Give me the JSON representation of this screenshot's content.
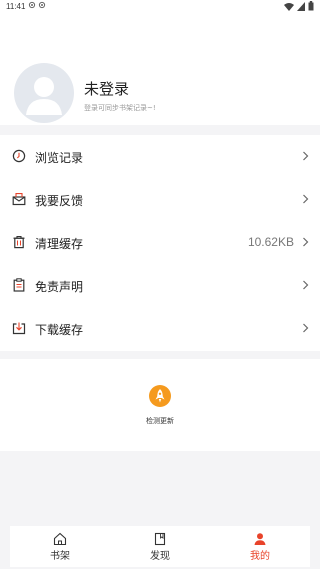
{
  "status_bar": {
    "time": "11:41"
  },
  "profile": {
    "name": "未登录",
    "subtitle": "登录可同步书架记录~!"
  },
  "menu": {
    "items": [
      {
        "label": "浏览记录",
        "icon": "history-icon"
      },
      {
        "label": "我要反馈",
        "icon": "feedback-icon"
      },
      {
        "label": "清理缓存",
        "icon": "trash-icon",
        "value": "10.62KB"
      },
      {
        "label": "免责声明",
        "icon": "clipboard-icon"
      },
      {
        "label": "下载缓存",
        "icon": "download-icon"
      }
    ]
  },
  "update": {
    "label": "检测更新",
    "icon": "rocket-icon",
    "accent": "#f59a1e"
  },
  "bottom_nav": {
    "items": [
      {
        "label": "书架",
        "icon": "home-icon"
      },
      {
        "label": "发现",
        "icon": "book-icon"
      },
      {
        "label": "我的",
        "icon": "user-icon",
        "active": true
      }
    ],
    "active_color": "#e8432a"
  }
}
